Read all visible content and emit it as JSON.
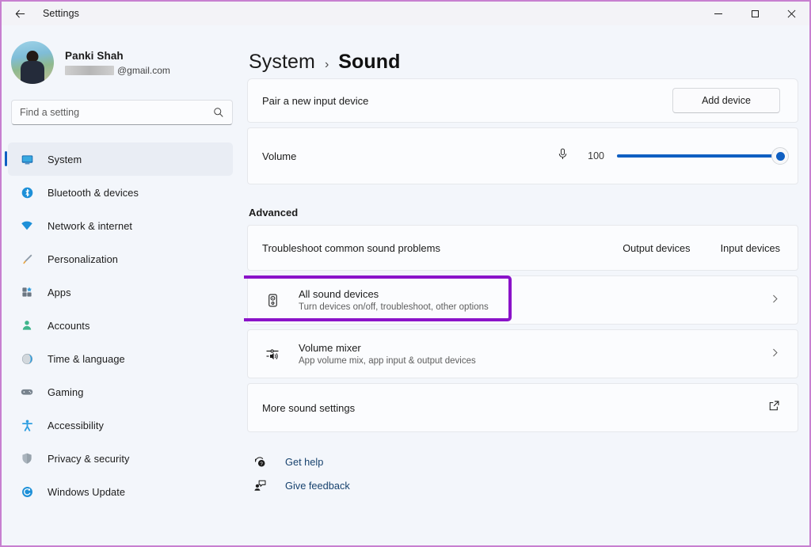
{
  "window": {
    "app_title": "Settings",
    "back_icon": "back-arrow-icon",
    "minimize_label": "Minimize",
    "maximize_label": "Maximize",
    "close_label": "Close",
    "border_color": "#c77fd0"
  },
  "sidebar": {
    "account": {
      "name": "Panki Shah",
      "email_suffix": "@gmail.com",
      "email_redacted": true,
      "avatar_icon": "avatar"
    },
    "search": {
      "placeholder": "Find a setting",
      "value": "",
      "icon": "search-icon"
    },
    "items": [
      {
        "label": "System",
        "icon": "monitor-icon",
        "selected": true
      },
      {
        "label": "Bluetooth & devices",
        "icon": "bluetooth-icon",
        "selected": false
      },
      {
        "label": "Network & internet",
        "icon": "wifi-icon",
        "selected": false
      },
      {
        "label": "Personalization",
        "icon": "paintbrush-icon",
        "selected": false
      },
      {
        "label": "Apps",
        "icon": "apps-icon",
        "selected": false
      },
      {
        "label": "Accounts",
        "icon": "person-icon",
        "selected": false
      },
      {
        "label": "Time & language",
        "icon": "clock-globe-icon",
        "selected": false
      },
      {
        "label": "Gaming",
        "icon": "gamepad-icon",
        "selected": false
      },
      {
        "label": "Accessibility",
        "icon": "accessibility-icon",
        "selected": false
      },
      {
        "label": "Privacy & security",
        "icon": "shield-icon",
        "selected": false
      },
      {
        "label": "Windows Update",
        "icon": "update-icon",
        "selected": false
      }
    ]
  },
  "main": {
    "breadcrumb": {
      "parent": "System",
      "separator": "›",
      "current": "Sound"
    },
    "pair_row": {
      "label": "Pair a new input device",
      "button": "Add device"
    },
    "volume_row": {
      "label": "Volume",
      "icon": "microphone-icon",
      "value": "100",
      "percent": 100
    },
    "advanced_heading": "Advanced",
    "troubleshoot_row": {
      "label": "Troubleshoot common sound problems",
      "links": [
        "Output devices",
        "Input devices"
      ]
    },
    "all_sound_devices": {
      "title": "All sound devices",
      "subtitle": "Turn devices on/off, troubleshoot, other options",
      "icon": "speaker-icon",
      "chevron": "chevron-right-icon",
      "highlighted": true,
      "highlight_color": "#8a13c9"
    },
    "volume_mixer": {
      "title": "Volume mixer",
      "subtitle": "App volume mix, app input & output devices",
      "icon": "mixer-icon",
      "chevron": "chevron-right-icon"
    },
    "more_sound_settings": {
      "title": "More sound settings",
      "icon": "external-link-icon"
    },
    "footer": [
      {
        "label": "Get help",
        "icon": "help-icon"
      },
      {
        "label": "Give feedback",
        "icon": "feedback-icon"
      }
    ]
  }
}
